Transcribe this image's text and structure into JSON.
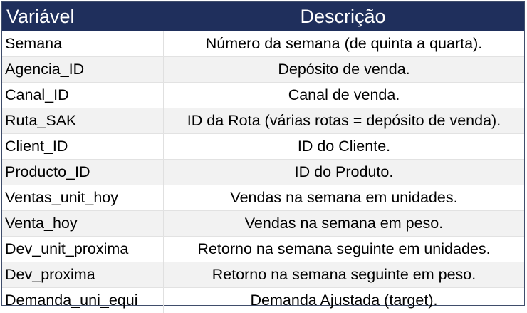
{
  "header": {
    "variable": "Variável",
    "description": "Descrição"
  },
  "rows": [
    {
      "variable": "Semana",
      "description": "Número da semana (de quinta a quarta)."
    },
    {
      "variable": "Agencia_ID",
      "description": "Depósito de venda."
    },
    {
      "variable": "Canal_ID",
      "description": "Canal de venda."
    },
    {
      "variable": "Ruta_SAK",
      "description": "ID da Rota (várias rotas = depósito de venda)."
    },
    {
      "variable": "Client_ID",
      "description": "ID do Cliente."
    },
    {
      "variable": "Producto_ID",
      "description": "ID do Produto."
    },
    {
      "variable": "Ventas_unit_hoy",
      "description": "Vendas na semana em unidades."
    },
    {
      "variable": "Venta_hoy",
      "description": "Vendas na semana em peso."
    },
    {
      "variable": "Dev_unit_proxima",
      "description": "Retorno na semana seguinte em unidades."
    },
    {
      "variable": "Dev_proxima",
      "description": "Retorno na semana seguinte em peso."
    },
    {
      "variable": "Demanda_uni_equi",
      "description": "Demanda Ajustada (target)."
    }
  ],
  "colors": {
    "header_bg": "#1f2f5c",
    "header_text": "#ffffff",
    "alt_row_bg": "#f2f2f2"
  }
}
